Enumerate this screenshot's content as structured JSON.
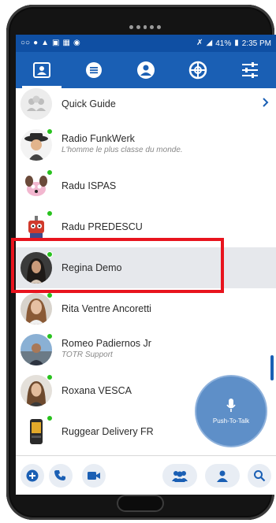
{
  "status_bar": {
    "battery": "41%",
    "time": "2:35 PM"
  },
  "nav_tabs": [
    {
      "icon": "contacts-icon",
      "active": true
    },
    {
      "icon": "chat-icon",
      "active": false
    },
    {
      "icon": "groups-icon",
      "active": false
    },
    {
      "icon": "channels-icon",
      "active": false
    },
    {
      "icon": "settings-icon",
      "active": false
    }
  ],
  "contacts": [
    {
      "name": "Quick Guide",
      "status": "",
      "online": false,
      "avatar": "guide-icon"
    },
    {
      "name": "Radio FunkWerk",
      "status": "L'homme le plus classe du monde.",
      "online": true,
      "avatar": "cowboy-avatar"
    },
    {
      "name": "Radu ISPAS",
      "status": "",
      "online": true,
      "avatar": "dog-avatar"
    },
    {
      "name": "Radu PREDESCU",
      "status": "",
      "online": true,
      "avatar": "robot-avatar"
    },
    {
      "name": "Regina Demo",
      "status": "",
      "online": true,
      "avatar": "woman-avatar",
      "selected": true
    },
    {
      "name": "Rita Ventre Ancoretti",
      "status": "",
      "online": true,
      "avatar": "woman-avatar"
    },
    {
      "name": "Romeo Padiernos Jr",
      "status": "TOTR Support",
      "online": true,
      "avatar": "man-avatar"
    },
    {
      "name": "Roxana VESCA",
      "status": "",
      "online": true,
      "avatar": "woman-avatar"
    },
    {
      "name": "Ruggear Delivery FR",
      "status": "",
      "online": true,
      "avatar": "device-avatar"
    }
  ],
  "ptt": {
    "label": "Push-To-Talk"
  },
  "bottom_bar": [
    "add-conversation-icon",
    "call-icon",
    "video-icon",
    "group-icon",
    "profile-icon",
    "search-icon"
  ],
  "colors": {
    "primary": "#1a5fb4",
    "status_bar": "#0f4fa3",
    "online": "#28c21e",
    "highlight": "#e8141e",
    "ptt": "#5e8fc8"
  }
}
